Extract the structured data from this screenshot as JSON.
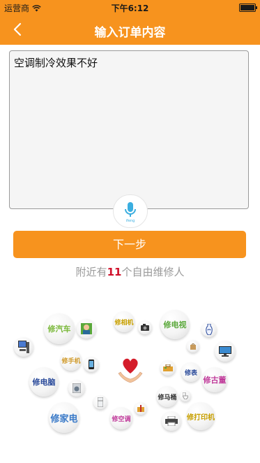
{
  "status_bar": {
    "carrier": "运营商",
    "time": "下午6:12"
  },
  "nav": {
    "title": "输入订单内容"
  },
  "order": {
    "text": "空调制冷效果不好"
  },
  "voice": {
    "label": "ifeng"
  },
  "next_button": {
    "label": "下一步"
  },
  "nearby": {
    "prefix": "附近有",
    "count": "11",
    "suffix": "个自由维修人"
  },
  "services": {
    "car": "修汽车",
    "camera": "修相机",
    "tv": "修电视",
    "phone": "修手机",
    "computer": "修电脑",
    "watch": "修表",
    "antique": "修古董",
    "toilet": "修马桶",
    "appliance": "修家电",
    "ac": "修空调",
    "printer": "修打印机"
  },
  "colors": {
    "brand": "#f7931e",
    "count": "#d0102a",
    "car": "#7ab83a",
    "camera": "#c8a000",
    "tv": "#5aa83a",
    "phone": "#d09a2a",
    "computer": "#2a4a9a",
    "watch": "#2a4a9a",
    "antique": "#c03a9a",
    "toilet": "#333333",
    "appliance": "#3a7ac8",
    "ac": "#c03a9a",
    "printer": "#c8a000"
  }
}
